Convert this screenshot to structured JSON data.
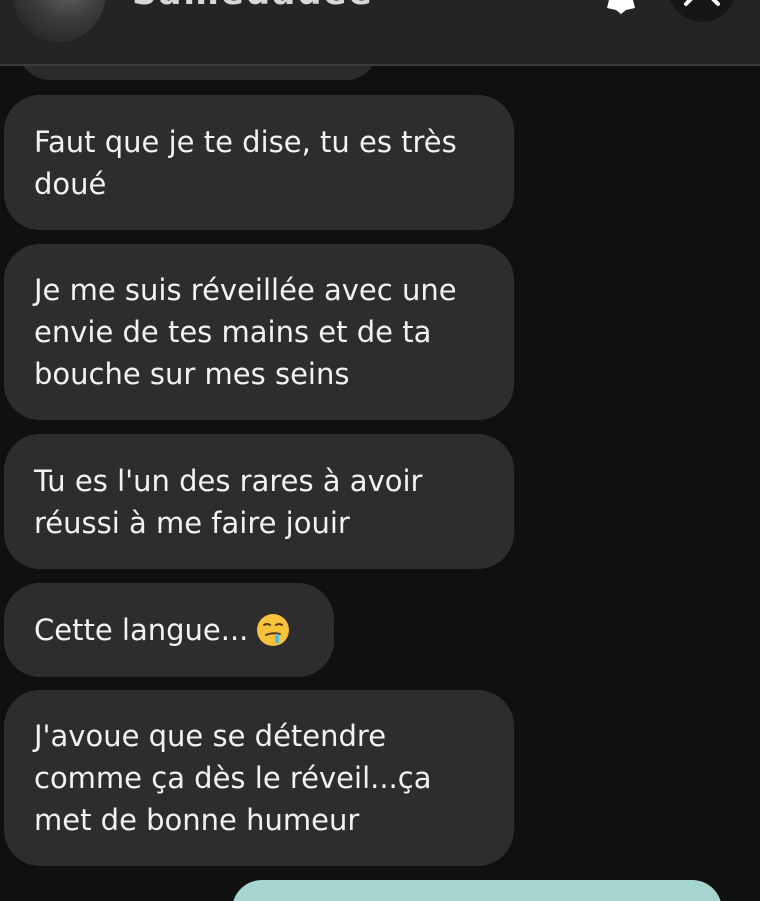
{
  "header": {
    "contact_name": "Samedadee",
    "gear_icon": "gear-icon",
    "close_icon": "close-icon"
  },
  "messages": [
    {
      "text": "Faut que je te dise, tu es très doué"
    },
    {
      "text": "Je me suis réveillée avec une envie de tes mains et de ta bouche sur mes seins"
    },
    {
      "text": "Tu es l'un des rares à avoir réussi à me faire jouir"
    },
    {
      "text": "Cette langue...",
      "emoji": "drooling-face-emoji"
    },
    {
      "text": "J'avoue que se détendre comme ça dès le réveil...ça met de bonne humeur"
    }
  ],
  "colors": {
    "background": "#101010",
    "header": "#242424",
    "bubble": "#2d2d2d",
    "text": "#f2f2f2",
    "accent": "#a6d4cf"
  }
}
